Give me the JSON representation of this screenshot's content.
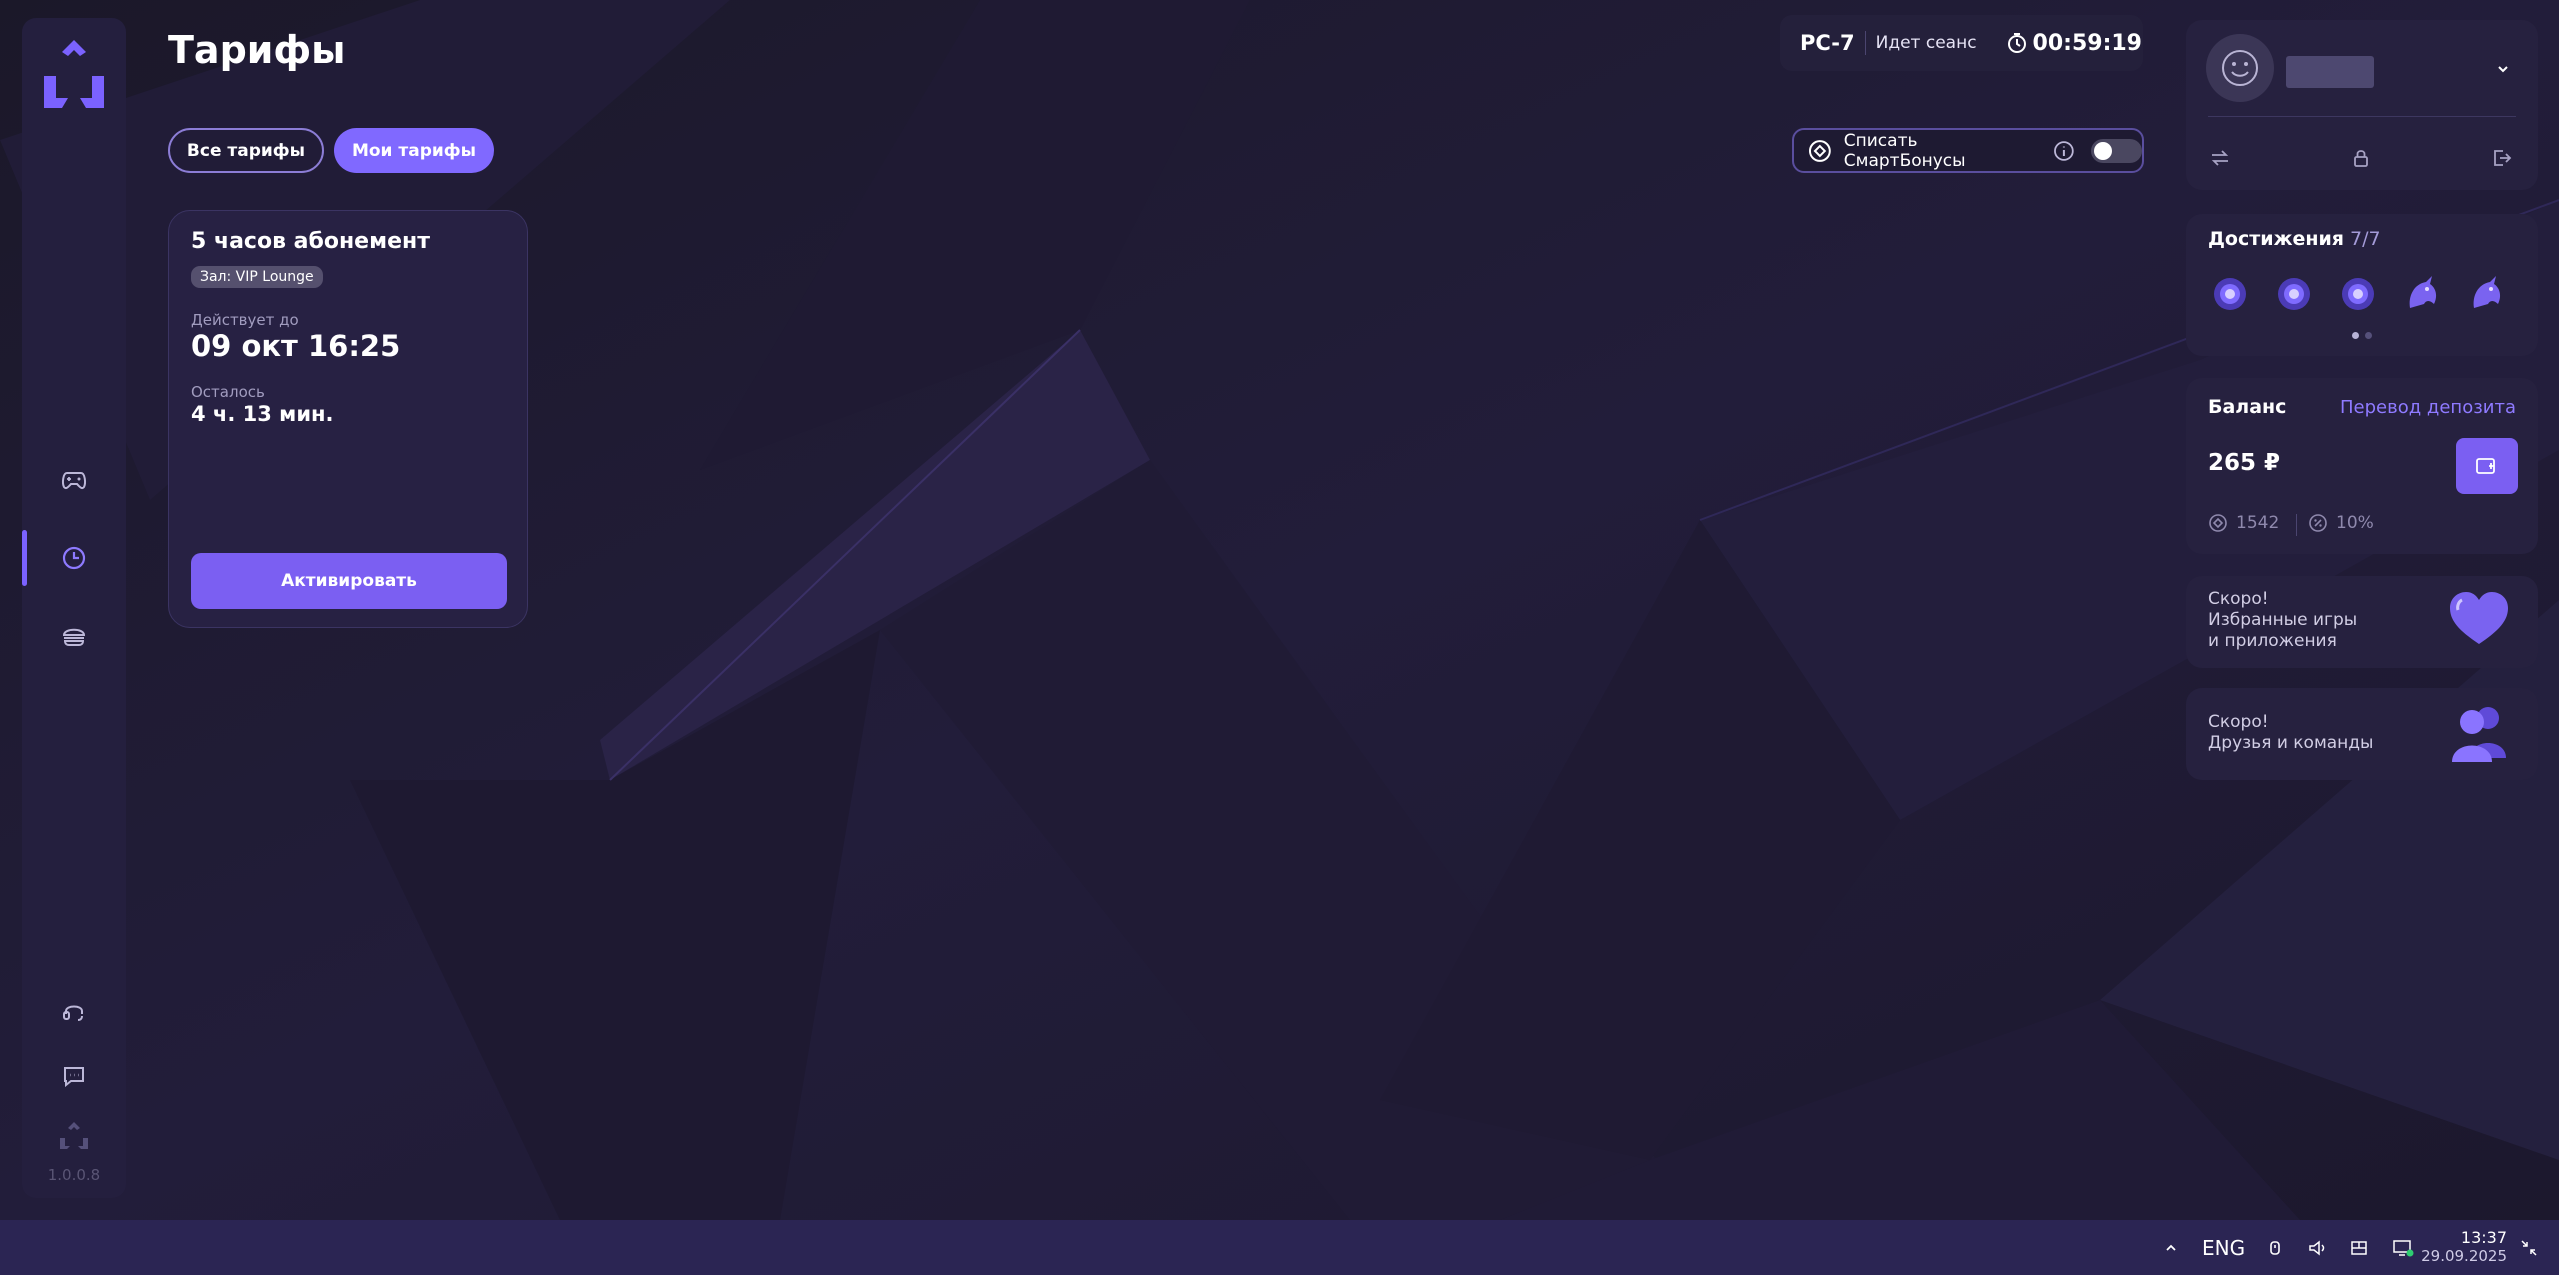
{
  "app": {
    "version": "1.0.0.8"
  },
  "page": {
    "title": "Тарифы"
  },
  "tabs": [
    {
      "label": "Все тарифы",
      "active": false
    },
    {
      "label": "Мои тарифы",
      "active": true
    }
  ],
  "session": {
    "pc": "PC-7",
    "status": "Идет сеанс",
    "timer": "00:59:19"
  },
  "smart_bonus": {
    "label": "Списать СмартБонусы",
    "enabled": false
  },
  "tariff": {
    "name": "5 часов абонемент",
    "hall": "Зал: VIP Lounge",
    "valid_label": "Действует до",
    "valid_until": "09 окт 16:25",
    "remaining_label": "Осталось",
    "remaining": "4 ч. 13 мин.",
    "activate_label": "Активировать"
  },
  "sidebar": {
    "items": [
      {
        "icon": "gamepad-icon",
        "active": false
      },
      {
        "icon": "clock-icon",
        "active": true
      },
      {
        "icon": "burger-icon",
        "active": false
      }
    ],
    "bottom": [
      "support-headset-icon",
      "chat-icon"
    ]
  },
  "achievements": {
    "title": "Достижения",
    "count": "7/7",
    "page": 1,
    "pages": 2
  },
  "balance": {
    "title": "Баланс",
    "transfer_label": "Перевод депозита",
    "amount": "265 ₽",
    "bonus_points": "1542",
    "discount": "10%"
  },
  "soon": [
    {
      "text": [
        "Скоро!",
        "Избранные игры",
        "и приложения"
      ],
      "icon": "heart-icon"
    },
    {
      "text": [
        "Скоро!",
        "Друзья и команды"
      ],
      "icon": "friends-icon"
    }
  ],
  "taskbar": {
    "language": "ENG",
    "time": "13:37",
    "date": "29.09.2025"
  },
  "colors": {
    "accent": "#7b5ff2",
    "accent_light": "#8e7aff",
    "panel": "#26213f",
    "background": "#1a1728"
  }
}
